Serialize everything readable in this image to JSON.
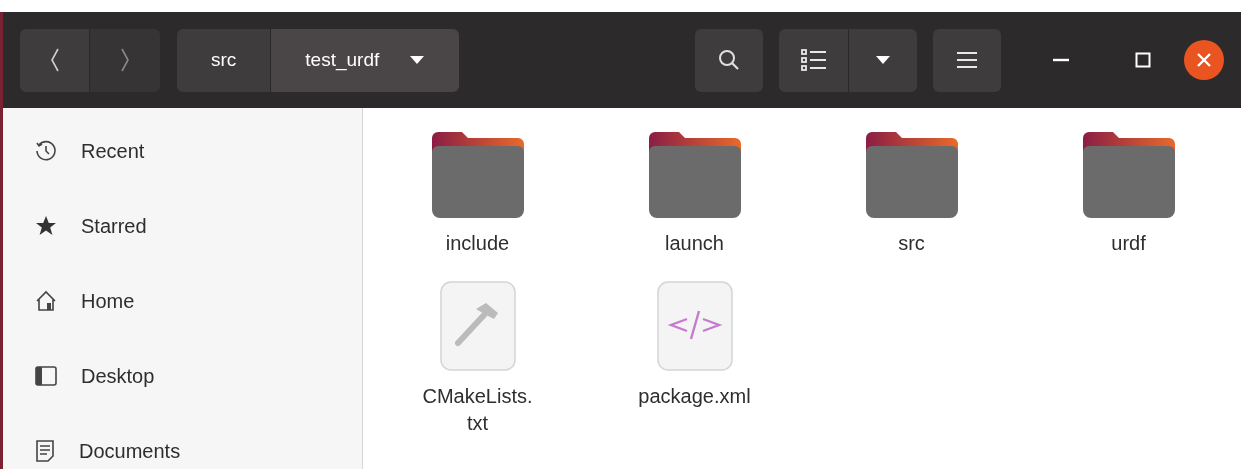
{
  "path_bar": {
    "segments": [
      {
        "label": "src",
        "selected": false
      },
      {
        "label": "test_urdf",
        "selected": true
      }
    ]
  },
  "sidebar": {
    "items": [
      {
        "label": "Recent",
        "kind": "recent"
      },
      {
        "label": "Starred",
        "kind": "starred"
      },
      {
        "label": "Home",
        "kind": "home"
      },
      {
        "label": "Desktop",
        "kind": "desktop"
      },
      {
        "label": "Documents",
        "kind": "documents"
      }
    ]
  },
  "files": [
    {
      "name": "include",
      "kind": "folder"
    },
    {
      "name": "launch",
      "kind": "folder"
    },
    {
      "name": "src",
      "kind": "folder"
    },
    {
      "name": "urdf",
      "kind": "folder"
    },
    {
      "name": "CMakeLists.txt",
      "kind": "cmake"
    },
    {
      "name": "package.xml",
      "kind": "xml"
    }
  ]
}
